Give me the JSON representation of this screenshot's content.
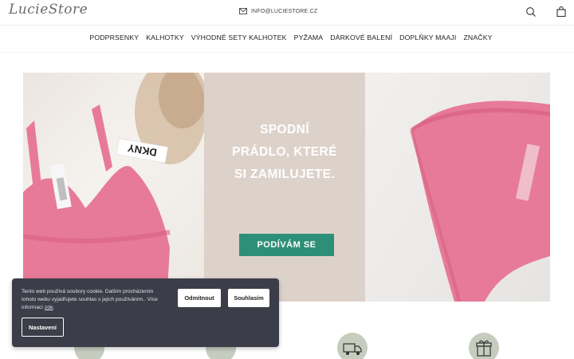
{
  "header": {
    "logo": "LucieStore",
    "email": "INFO@LUCIESTORE.CZ",
    "icons": [
      "mail-icon",
      "search-icon",
      "shopping-bag-icon"
    ]
  },
  "nav": {
    "items": [
      {
        "label": "PODPRSENKY"
      },
      {
        "label": "KALHOTKY"
      },
      {
        "label": "VÝHODNÉ SETY KALHOTEK"
      },
      {
        "label": "PYŽAMA"
      },
      {
        "label": "DÁRKOVÉ BALENÍ"
      },
      {
        "label": "DOPLŇKY MAAJI"
      },
      {
        "label": "ZNAČKY"
      }
    ]
  },
  "hero": {
    "title_lines": [
      "SPODNÍ",
      "PRÁDLO, KTERÉ",
      "SI ZAMILUJETE."
    ],
    "button_label": "PODÍVÁM SE",
    "tag_text": "DKNY",
    "colors": {
      "panel": "#ddd2ca",
      "button": "#2e8f79",
      "lingerie": "#e77a99"
    }
  },
  "cookie": {
    "text_main": "Tento web používá soubory cookie. Dalším procházením tohoto webu vyjadřujete souhlas s jejich používáním.. Více informací",
    "link_label": "zde",
    "text_end": ".",
    "decline_label": "Odmítnout",
    "accept_label": "Souhlasím",
    "settings_label": "Nastavení",
    "colors": {
      "background": "#3b3e48"
    }
  },
  "features": {
    "icons": [
      "package-icon",
      "delivery-truck-icon",
      "delivery-van-icon",
      "gift-icon"
    ]
  }
}
